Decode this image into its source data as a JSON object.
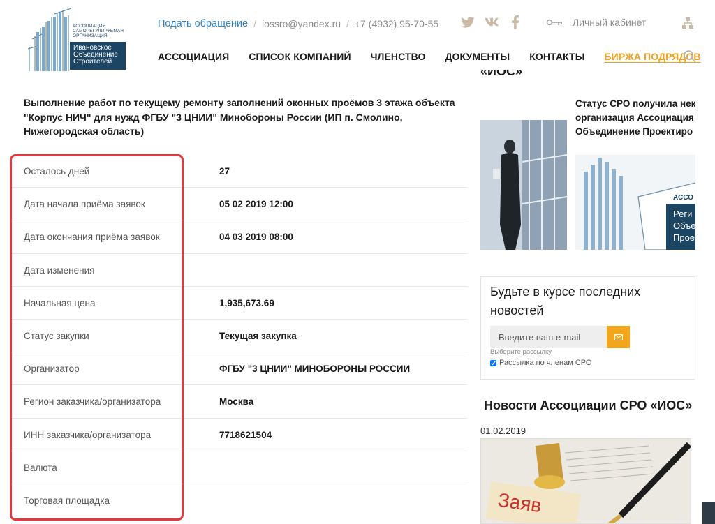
{
  "logo": {
    "top_text": [
      "Ассоциация",
      "саморегулируемая",
      "организация"
    ],
    "box_text": [
      "Ивановское",
      "Объединение",
      "Строителей"
    ]
  },
  "topbar": {
    "appeal_link": "Подать обращение",
    "email": "iossro@yandex.ru",
    "phone": "+7 (4932) 95-70-55",
    "cabinet": "Личный кабинет"
  },
  "nav": {
    "items": [
      "АССОЦИАЦИЯ",
      "СПИСОК КОМПАНИЙ",
      "ЧЛЕНСТВО",
      "ДОКУМЕНТЫ",
      "КОНТАКТЫ"
    ],
    "accent_item": "БИРЖА ПОДРЯДОВ"
  },
  "main": {
    "title": "Выполнение работ по текущему ремонту заполнений оконных проёмов 3 этажа объекта \"Корпус НИЧ\" для нужд ФГБУ \"3 ЦНИИ\" Минобороны России (ИП п. Смолино, Нижегородская область)",
    "details": [
      {
        "label": "Осталось дней",
        "value": "27"
      },
      {
        "label": "Дата начала приёма заявок",
        "value": "05 02 2019 12:00"
      },
      {
        "label": "Дата окончания приёма заявок",
        "value": "04 03 2019 08:00"
      },
      {
        "label": "Дата изменения",
        "value": ""
      },
      {
        "label": "Начальная цена",
        "value": "1,935,673.69"
      },
      {
        "label": "Статус закупки",
        "value": "Текущая закупка"
      },
      {
        "label": "Организатор",
        "value": "ФГБУ \"3 ЦНИИ\" МИНОБОРОНЫ РОССИИ"
      },
      {
        "label": "Регион заказчика/организатора",
        "value": "Москва"
      },
      {
        "label": "ИНН заказчика/организатора",
        "value": "7718621504"
      },
      {
        "label": "Валюта",
        "value": ""
      },
      {
        "label": "Торговая площадка",
        "value": ""
      }
    ]
  },
  "sidebar": {
    "cut_heading": "«ИОС»",
    "news1_lines": [
      "Статус СРО получила нек",
      "организация Ассоциация",
      "Объединение Проектиро"
    ],
    "news1_logo_text": [
      "АССО",
      "Реги",
      "Объе",
      "Проe"
    ],
    "subscribe": {
      "title": "Будьте в курсе последних новостей",
      "placeholder": "Введите ваш e-mail",
      "hint": "Выберите рассылку",
      "checkbox_label": "Рассылка по членам СРО",
      "checked": true
    },
    "news_heading": "Новости Ассоциации СРО «ИОС»",
    "news_date": "01.02.2019",
    "news_img_text": "Заяв"
  },
  "colors": {
    "link_blue": "#2f83c6",
    "accent_orange": "#f0a11e",
    "highlight_red": "#e3393c",
    "logo_navy": "#1c4463",
    "subscribe_btn": "#f2a61b"
  }
}
